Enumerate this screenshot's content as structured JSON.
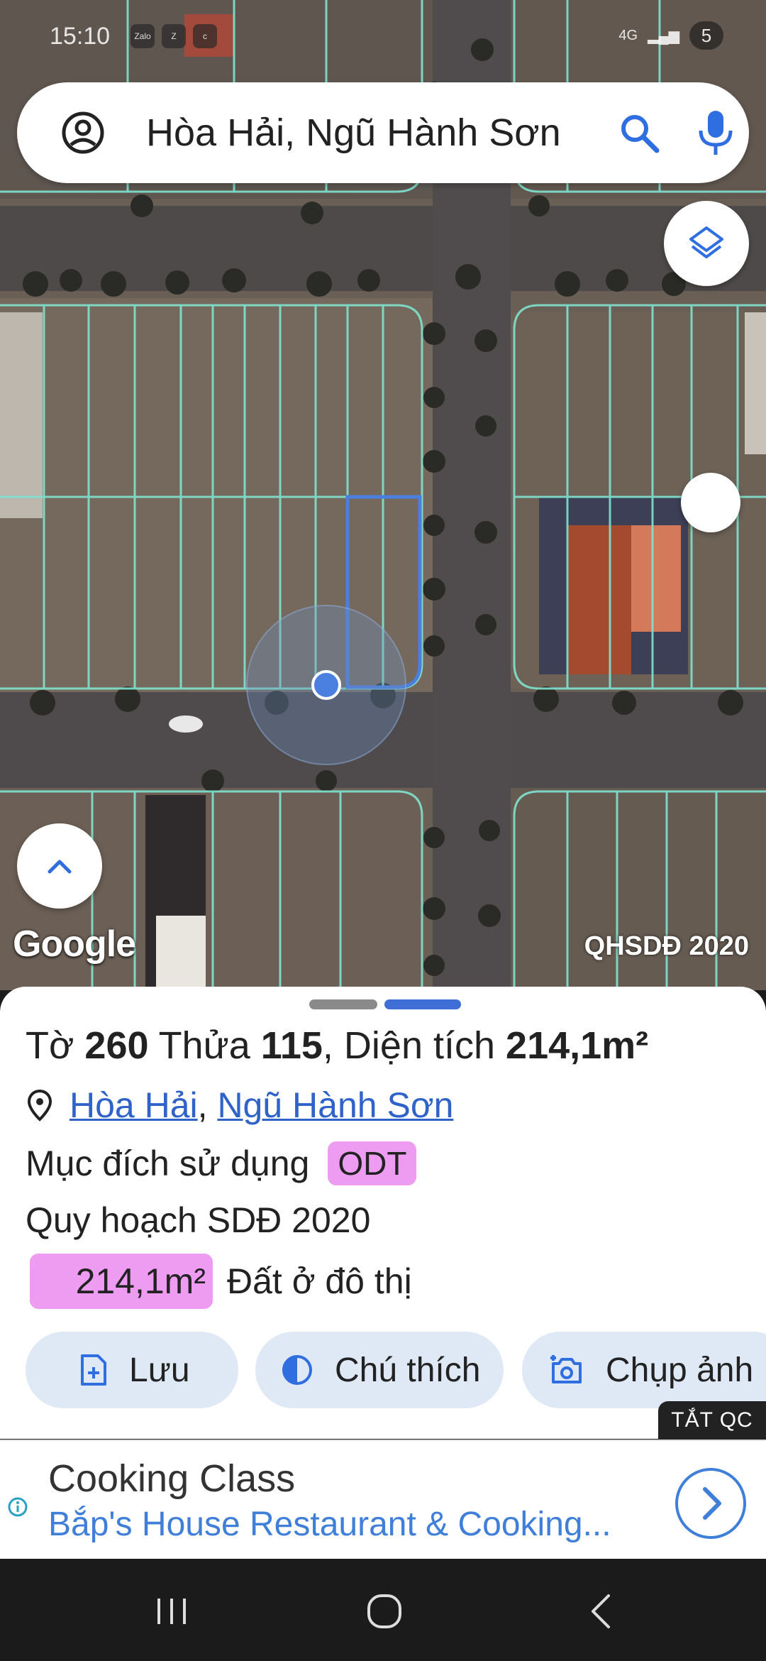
{
  "status_bar": {
    "time": "15:10",
    "apps": [
      "Zalo",
      "Z",
      "c"
    ],
    "network": "4G",
    "battery": "5"
  },
  "search": {
    "query": "Hòa Hải, Ngũ Hành Sơn"
  },
  "map": {
    "brand": "Google",
    "attribution": "QHSDĐ 2020"
  },
  "parcel": {
    "sheet_label": "Tờ",
    "sheet_no": "260",
    "lot_label": "Thửa",
    "lot_no": "115",
    "area_label": ", Diện tích",
    "area": "214,1m²",
    "ward": "Hòa Hải",
    "district": "Ngũ Hành Sơn",
    "purpose_label": "Mục đích sử dụng",
    "purpose_code": "ODT",
    "plan_label": "Quy hoạch SDĐ 2020",
    "plan_area": "214,1m²",
    "plan_use": "Đất ở đô thị"
  },
  "actions": {
    "save": "Lưu",
    "legend": "Chú thích",
    "capture": "Chụp ảnh"
  },
  "ad": {
    "close_label": "TẮT QC",
    "title": "Cooking Class",
    "subtitle": "Bắp's House Restaurant & Cooking..."
  },
  "colors": {
    "accent": "#3f6fd6",
    "badge": "#ee9cf2",
    "action_bg": "#dfe8f5",
    "link": "#2f63c9",
    "parcel_lines": "#7fe3cf",
    "selected_parcel": "#4a7fe0"
  },
  "icons": [
    "account-icon",
    "search-icon",
    "mic-icon",
    "layers-icon",
    "chevron-up-icon",
    "location-pin-icon",
    "add-file-icon",
    "contrast-icon",
    "camera-icon",
    "info-icon",
    "chevron-right-icon",
    "recents-icon",
    "home-icon",
    "back-icon"
  ]
}
